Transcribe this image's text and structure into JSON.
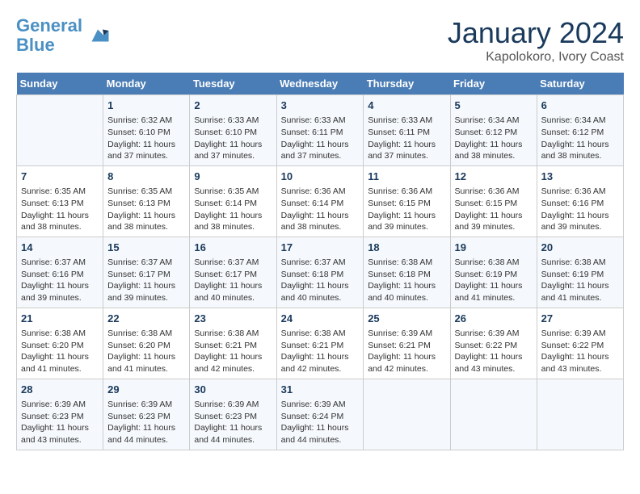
{
  "header": {
    "logo_line1": "General",
    "logo_line2": "Blue",
    "month": "January 2024",
    "location": "Kapolokoro, Ivory Coast"
  },
  "days_of_week": [
    "Sunday",
    "Monday",
    "Tuesday",
    "Wednesday",
    "Thursday",
    "Friday",
    "Saturday"
  ],
  "weeks": [
    [
      {
        "day": "",
        "content": ""
      },
      {
        "day": "1",
        "content": "Sunrise: 6:32 AM\nSunset: 6:10 PM\nDaylight: 11 hours\nand 37 minutes."
      },
      {
        "day": "2",
        "content": "Sunrise: 6:33 AM\nSunset: 6:10 PM\nDaylight: 11 hours\nand 37 minutes."
      },
      {
        "day": "3",
        "content": "Sunrise: 6:33 AM\nSunset: 6:11 PM\nDaylight: 11 hours\nand 37 minutes."
      },
      {
        "day": "4",
        "content": "Sunrise: 6:33 AM\nSunset: 6:11 PM\nDaylight: 11 hours\nand 37 minutes."
      },
      {
        "day": "5",
        "content": "Sunrise: 6:34 AM\nSunset: 6:12 PM\nDaylight: 11 hours\nand 38 minutes."
      },
      {
        "day": "6",
        "content": "Sunrise: 6:34 AM\nSunset: 6:12 PM\nDaylight: 11 hours\nand 38 minutes."
      }
    ],
    [
      {
        "day": "7",
        "content": "Sunrise: 6:35 AM\nSunset: 6:13 PM\nDaylight: 11 hours\nand 38 minutes."
      },
      {
        "day": "8",
        "content": "Sunrise: 6:35 AM\nSunset: 6:13 PM\nDaylight: 11 hours\nand 38 minutes."
      },
      {
        "day": "9",
        "content": "Sunrise: 6:35 AM\nSunset: 6:14 PM\nDaylight: 11 hours\nand 38 minutes."
      },
      {
        "day": "10",
        "content": "Sunrise: 6:36 AM\nSunset: 6:14 PM\nDaylight: 11 hours\nand 38 minutes."
      },
      {
        "day": "11",
        "content": "Sunrise: 6:36 AM\nSunset: 6:15 PM\nDaylight: 11 hours\nand 39 minutes."
      },
      {
        "day": "12",
        "content": "Sunrise: 6:36 AM\nSunset: 6:15 PM\nDaylight: 11 hours\nand 39 minutes."
      },
      {
        "day": "13",
        "content": "Sunrise: 6:36 AM\nSunset: 6:16 PM\nDaylight: 11 hours\nand 39 minutes."
      }
    ],
    [
      {
        "day": "14",
        "content": "Sunrise: 6:37 AM\nSunset: 6:16 PM\nDaylight: 11 hours\nand 39 minutes."
      },
      {
        "day": "15",
        "content": "Sunrise: 6:37 AM\nSunset: 6:17 PM\nDaylight: 11 hours\nand 39 minutes."
      },
      {
        "day": "16",
        "content": "Sunrise: 6:37 AM\nSunset: 6:17 PM\nDaylight: 11 hours\nand 40 minutes."
      },
      {
        "day": "17",
        "content": "Sunrise: 6:37 AM\nSunset: 6:18 PM\nDaylight: 11 hours\nand 40 minutes."
      },
      {
        "day": "18",
        "content": "Sunrise: 6:38 AM\nSunset: 6:18 PM\nDaylight: 11 hours\nand 40 minutes."
      },
      {
        "day": "19",
        "content": "Sunrise: 6:38 AM\nSunset: 6:19 PM\nDaylight: 11 hours\nand 41 minutes."
      },
      {
        "day": "20",
        "content": "Sunrise: 6:38 AM\nSunset: 6:19 PM\nDaylight: 11 hours\nand 41 minutes."
      }
    ],
    [
      {
        "day": "21",
        "content": "Sunrise: 6:38 AM\nSunset: 6:20 PM\nDaylight: 11 hours\nand 41 minutes."
      },
      {
        "day": "22",
        "content": "Sunrise: 6:38 AM\nSunset: 6:20 PM\nDaylight: 11 hours\nand 41 minutes."
      },
      {
        "day": "23",
        "content": "Sunrise: 6:38 AM\nSunset: 6:21 PM\nDaylight: 11 hours\nand 42 minutes."
      },
      {
        "day": "24",
        "content": "Sunrise: 6:38 AM\nSunset: 6:21 PM\nDaylight: 11 hours\nand 42 minutes."
      },
      {
        "day": "25",
        "content": "Sunrise: 6:39 AM\nSunset: 6:21 PM\nDaylight: 11 hours\nand 42 minutes."
      },
      {
        "day": "26",
        "content": "Sunrise: 6:39 AM\nSunset: 6:22 PM\nDaylight: 11 hours\nand 43 minutes."
      },
      {
        "day": "27",
        "content": "Sunrise: 6:39 AM\nSunset: 6:22 PM\nDaylight: 11 hours\nand 43 minutes."
      }
    ],
    [
      {
        "day": "28",
        "content": "Sunrise: 6:39 AM\nSunset: 6:23 PM\nDaylight: 11 hours\nand 43 minutes."
      },
      {
        "day": "29",
        "content": "Sunrise: 6:39 AM\nSunset: 6:23 PM\nDaylight: 11 hours\nand 44 minutes."
      },
      {
        "day": "30",
        "content": "Sunrise: 6:39 AM\nSunset: 6:23 PM\nDaylight: 11 hours\nand 44 minutes."
      },
      {
        "day": "31",
        "content": "Sunrise: 6:39 AM\nSunset: 6:24 PM\nDaylight: 11 hours\nand 44 minutes."
      },
      {
        "day": "",
        "content": ""
      },
      {
        "day": "",
        "content": ""
      },
      {
        "day": "",
        "content": ""
      }
    ]
  ]
}
